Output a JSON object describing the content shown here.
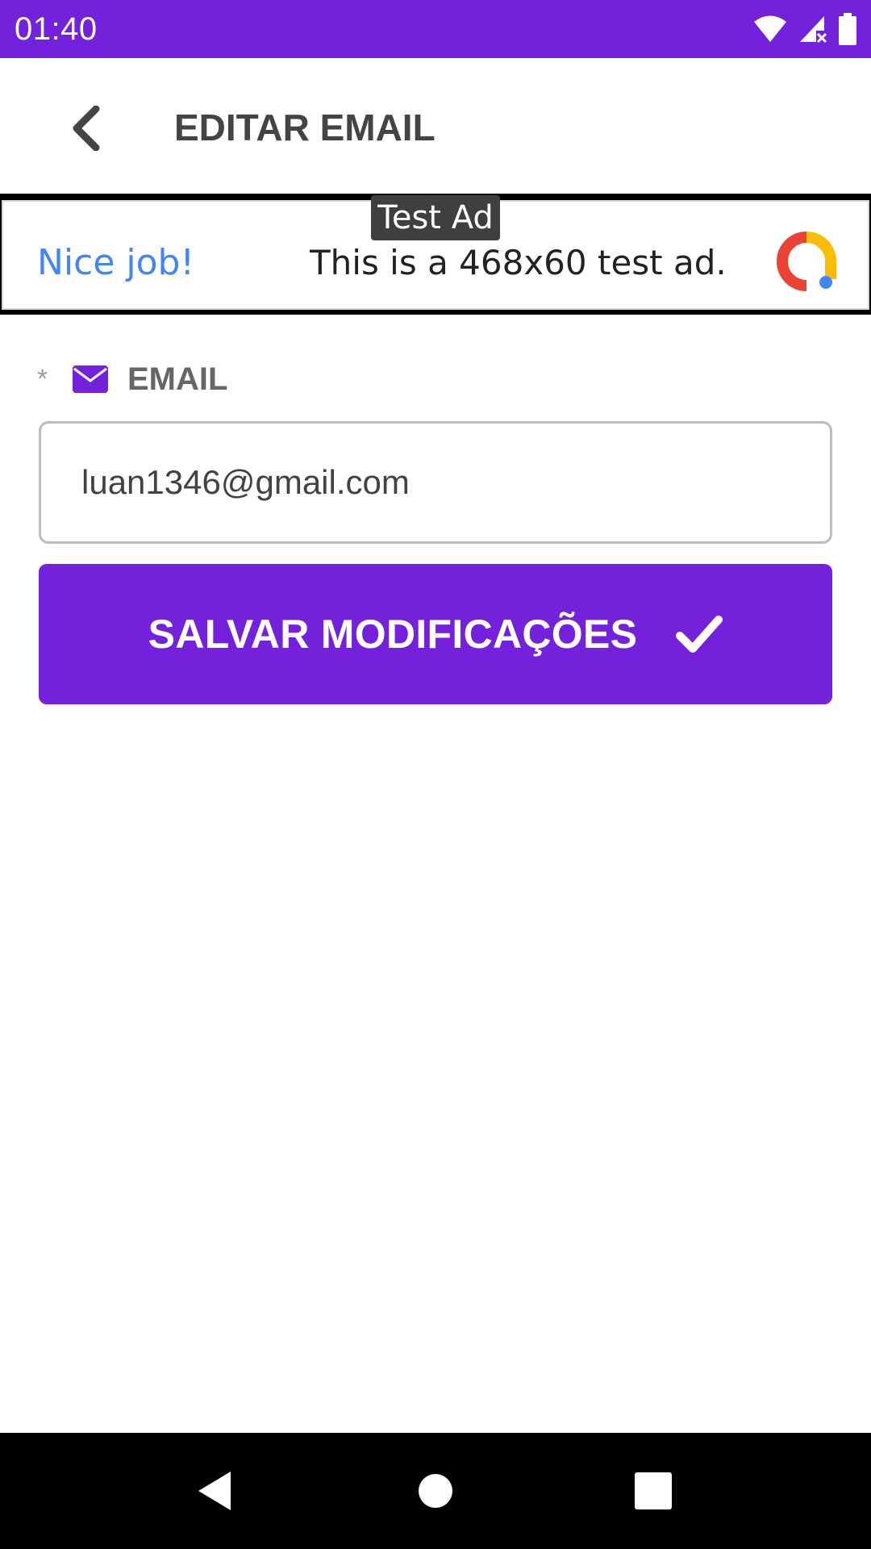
{
  "status_bar": {
    "time": "01:40",
    "background": "#7421dc",
    "icons": [
      "wifi-icon",
      "signal-no-data-icon",
      "battery-icon"
    ]
  },
  "app_bar": {
    "title": "EDITAR EMAIL",
    "back_icon": "chevron-left-icon"
  },
  "ad": {
    "badge": "Test Ad",
    "headline": "Nice job!",
    "body": "This is a 468x60 test ad.",
    "logo_icon": "admob-logo-icon"
  },
  "form": {
    "required_mark": "*",
    "label_icon": "envelope-icon",
    "label": "EMAIL",
    "email_value": "luan1346@gmail.com",
    "save_label": "SALVAR MODIFICAÇÕES",
    "save_icon": "check-icon"
  },
  "nav_bar": {
    "buttons": [
      "back-triangle-icon",
      "home-circle-icon",
      "recents-square-icon"
    ]
  },
  "colors": {
    "accent": "#7421dc",
    "title_text": "#444444",
    "ad_headline": "#4285f4"
  }
}
